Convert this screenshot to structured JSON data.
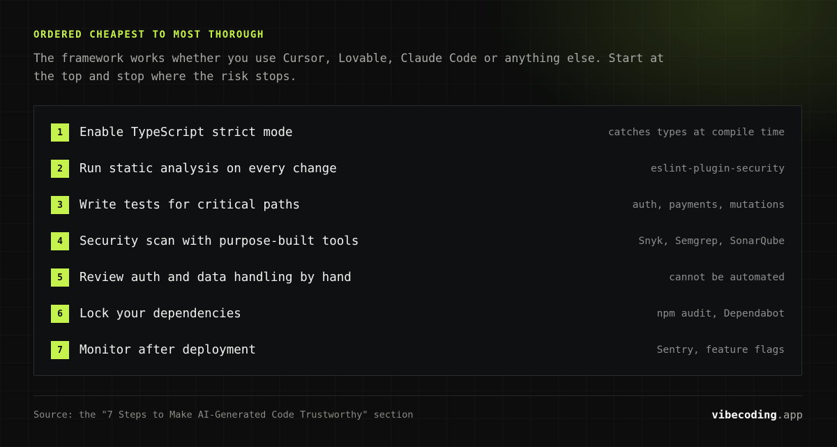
{
  "header": {
    "eyebrow": "ORDERED CHEAPEST TO MOST THOROUGH",
    "intro": "The framework works whether you use Cursor, Lovable, Claude Code or anything else. Start at the top and stop where the risk stops."
  },
  "steps": [
    {
      "number": "1",
      "title": "Enable TypeScript strict mode",
      "note": "catches types at compile time"
    },
    {
      "number": "2",
      "title": "Run static analysis on every change",
      "note": "eslint-plugin-security"
    },
    {
      "number": "3",
      "title": "Write tests for critical paths",
      "note": "auth, payments, mutations"
    },
    {
      "number": "4",
      "title": "Security scan with purpose-built tools",
      "note": "Snyk, Semgrep, SonarQube"
    },
    {
      "number": "5",
      "title": "Review auth and data handling by hand",
      "note": "cannot be automated"
    },
    {
      "number": "6",
      "title": "Lock your dependencies",
      "note": "npm audit, Dependabot"
    },
    {
      "number": "7",
      "title": "Monitor after deployment",
      "note": "Sentry, feature flags"
    }
  ],
  "footer": {
    "source": "Source: the \"7 Steps to Make AI-Generated Code Trustworthy\" section",
    "brand_name": "vibecoding",
    "brand_tld": ".app"
  },
  "colors": {
    "accent": "#c6f24e",
    "background": "#0c0d0c",
    "panel": "#0f1012"
  }
}
